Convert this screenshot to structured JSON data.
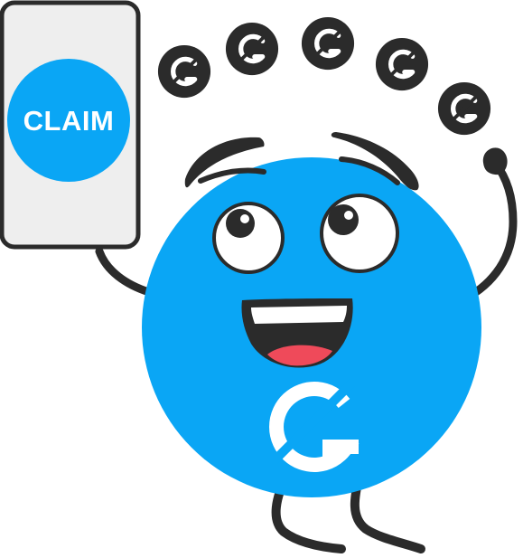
{
  "phone": {
    "button_label": "CLAIM"
  },
  "coins": {
    "glyph": "G",
    "icon": "coin-g-logo-icon"
  },
  "mascot": {
    "icon": "blue-mascot-icon",
    "logo_icon": "g-logo-icon"
  },
  "colors": {
    "brand_blue": "#0AA6F5",
    "dark": "#2B2B2B",
    "phone_screen": "#EEEEEE",
    "tongue": "#EF4A5A",
    "white": "#FFFFFF"
  }
}
